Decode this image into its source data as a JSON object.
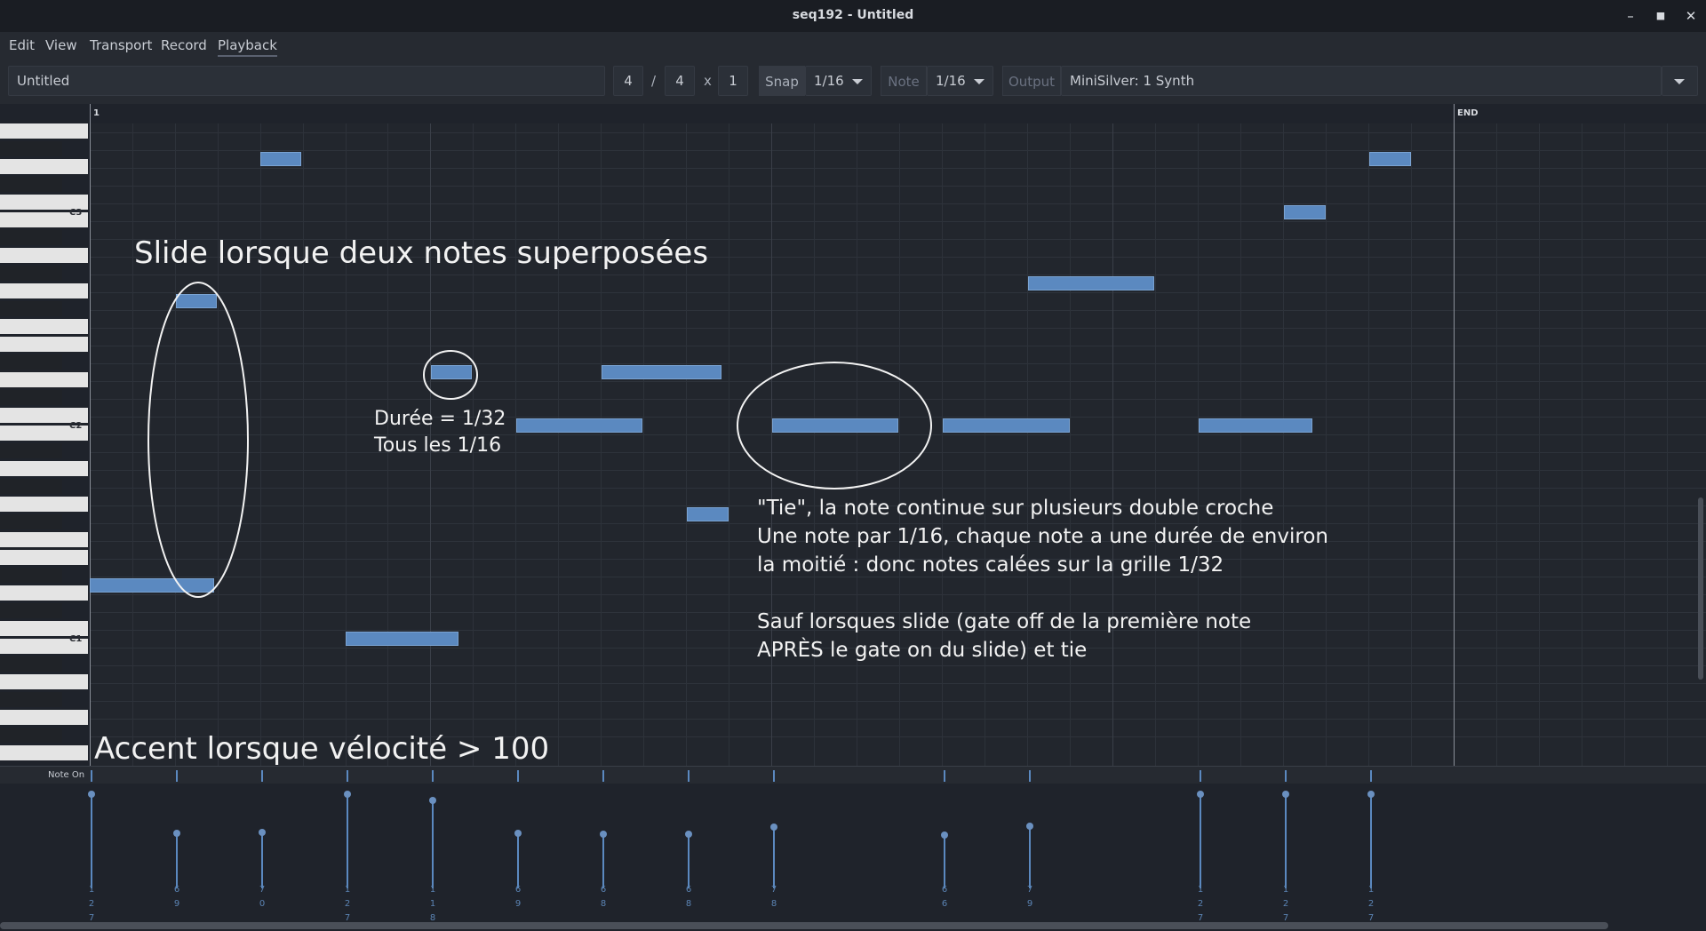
{
  "window": {
    "title": "seq192 - Untitled",
    "controls": [
      "minimize-icon",
      "maximize-icon",
      "close-icon"
    ]
  },
  "menu": [
    "Edit",
    "View",
    "Transport",
    "Record",
    "Playback"
  ],
  "toolbar": {
    "name": "Untitled",
    "beats_per_bar": "4",
    "separator": "/",
    "beat_width": "4",
    "times": "x",
    "measures": "1",
    "snap_label": "Snap",
    "snap_value": "1/16",
    "note_label": "Note",
    "note_value": "1/16",
    "output_label": "Output",
    "output_value": "MiniSilver: 1 Synth"
  },
  "ruler": {
    "start": "1",
    "end": "END"
  },
  "keys": {
    "octaves": [
      "C3",
      "C2",
      "C1"
    ]
  },
  "annotations": {
    "slide": "Slide lorsque deux notes superposées",
    "duration_1": "Durée = 1/32",
    "duration_2": "Tous les 1/16",
    "tie_1": "\"Tie\", la note continue sur plusieurs double croche",
    "tie_2": "Une note par 1/16, chaque note a une durée de environ",
    "tie_3": "la moitié : donc notes calées sur la grille 1/32",
    "sauf_1": "Sauf lorsques slide (gate off de la première note",
    "sauf_2": "APRÈS le gate on du slide) et tie",
    "accent": "Accent lorsque vélocité > 100"
  },
  "event_lane": {
    "label": "Note On"
  },
  "velocities": [
    "127",
    "69",
    "70",
    "127",
    "118",
    "69",
    "68",
    "68",
    "78",
    "66",
    "79",
    "127",
    "127",
    "127"
  ],
  "colors": {
    "note": "#5b89c0",
    "background": "#1f232b",
    "annotation": "#f2f2f2"
  }
}
